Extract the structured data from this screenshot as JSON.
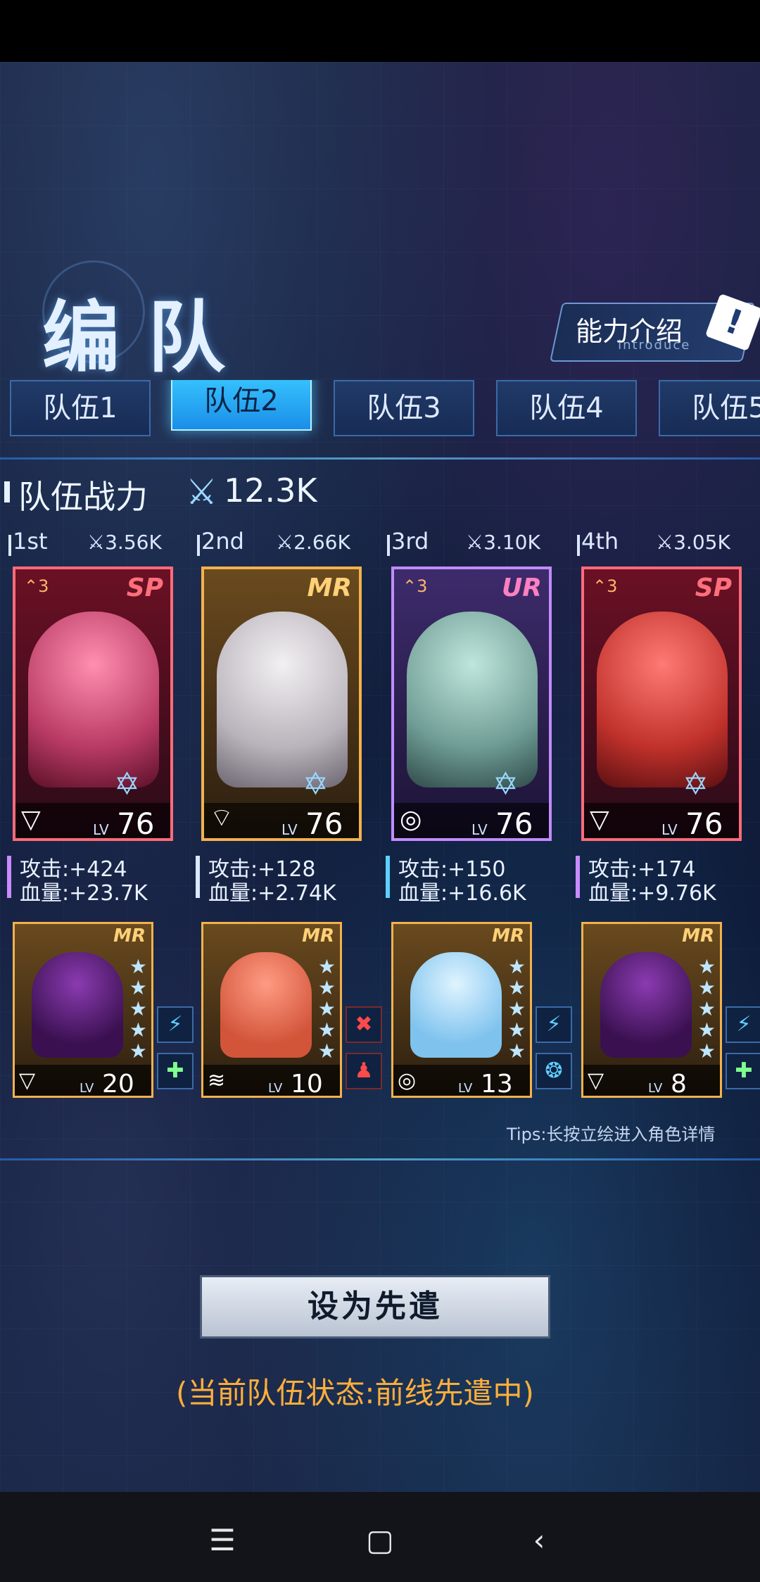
{
  "title": "编队",
  "intro": {
    "label": "能力介绍",
    "sub": "introduce"
  },
  "tabs": [
    "队伍1",
    "队伍2",
    "队伍3",
    "队伍4",
    "队伍5"
  ],
  "active_tab": 1,
  "power": {
    "label": "队伍战力",
    "value": "12.3K"
  },
  "cards": [
    {
      "rank": "1st",
      "power": "3.56K",
      "rarity": "SP",
      "ascend": "3",
      "level": "76",
      "attack": "攻击:+424",
      "hp": "血量:+23.7K",
      "support": {
        "rarity": "MR",
        "level": "20"
      }
    },
    {
      "rank": "2nd",
      "power": "2.66K",
      "rarity": "MR",
      "ascend": "",
      "level": "76",
      "attack": "攻击:+128",
      "hp": "血量:+2.74K",
      "support": {
        "rarity": "MR",
        "level": "10"
      }
    },
    {
      "rank": "3rd",
      "power": "3.10K",
      "rarity": "UR",
      "ascend": "3",
      "level": "76",
      "attack": "攻击:+150",
      "hp": "血量:+16.6K",
      "support": {
        "rarity": "MR",
        "level": "13"
      }
    },
    {
      "rank": "4th",
      "power": "3.05K",
      "rarity": "SP",
      "ascend": "3",
      "level": "76",
      "attack": "攻击:+174",
      "hp": "血量:+9.76K",
      "support": {
        "rarity": "MR",
        "level": "8"
      }
    }
  ],
  "lv_label": "LV",
  "tips": "Tips:长按立绘进入角色详情",
  "action_button": "设为先遣",
  "status_text": "(当前队伍状态:前线先遣中)",
  "colors": {
    "accent": "#38c6ff",
    "status": "#ffae3b",
    "sp": "#ff6b78",
    "mr": "#f2b24c",
    "ur": "#c28bff"
  },
  "icons": {
    "power": "sword-icon",
    "star_badge": "hexagram-icon"
  }
}
